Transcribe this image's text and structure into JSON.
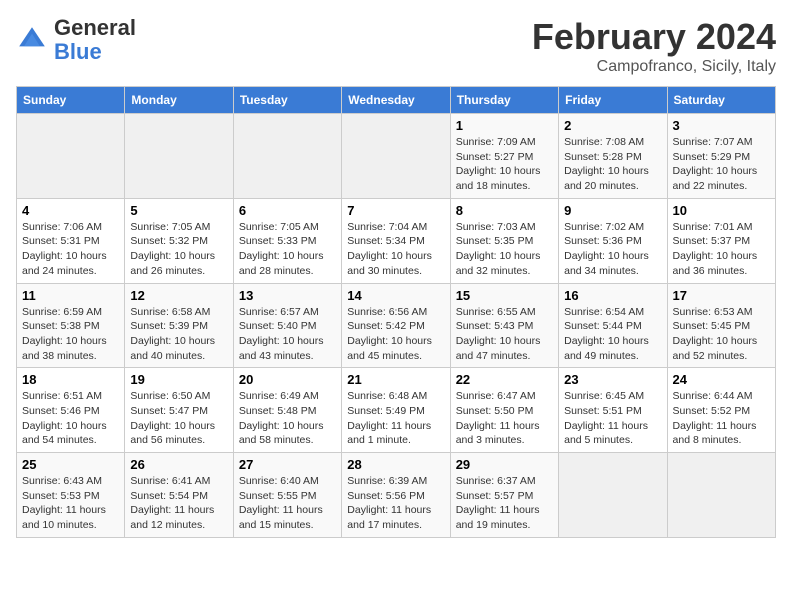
{
  "header": {
    "logo_general": "General",
    "logo_blue": "Blue",
    "title": "February 2024",
    "location": "Campofranco, Sicily, Italy"
  },
  "weekdays": [
    "Sunday",
    "Monday",
    "Tuesday",
    "Wednesday",
    "Thursday",
    "Friday",
    "Saturday"
  ],
  "weeks": [
    [
      {
        "day": "",
        "text": ""
      },
      {
        "day": "",
        "text": ""
      },
      {
        "day": "",
        "text": ""
      },
      {
        "day": "",
        "text": ""
      },
      {
        "day": "1",
        "text": "Sunrise: 7:09 AM\nSunset: 5:27 PM\nDaylight: 10 hours\nand 18 minutes."
      },
      {
        "day": "2",
        "text": "Sunrise: 7:08 AM\nSunset: 5:28 PM\nDaylight: 10 hours\nand 20 minutes."
      },
      {
        "day": "3",
        "text": "Sunrise: 7:07 AM\nSunset: 5:29 PM\nDaylight: 10 hours\nand 22 minutes."
      }
    ],
    [
      {
        "day": "4",
        "text": "Sunrise: 7:06 AM\nSunset: 5:31 PM\nDaylight: 10 hours\nand 24 minutes."
      },
      {
        "day": "5",
        "text": "Sunrise: 7:05 AM\nSunset: 5:32 PM\nDaylight: 10 hours\nand 26 minutes."
      },
      {
        "day": "6",
        "text": "Sunrise: 7:05 AM\nSunset: 5:33 PM\nDaylight: 10 hours\nand 28 minutes."
      },
      {
        "day": "7",
        "text": "Sunrise: 7:04 AM\nSunset: 5:34 PM\nDaylight: 10 hours\nand 30 minutes."
      },
      {
        "day": "8",
        "text": "Sunrise: 7:03 AM\nSunset: 5:35 PM\nDaylight: 10 hours\nand 32 minutes."
      },
      {
        "day": "9",
        "text": "Sunrise: 7:02 AM\nSunset: 5:36 PM\nDaylight: 10 hours\nand 34 minutes."
      },
      {
        "day": "10",
        "text": "Sunrise: 7:01 AM\nSunset: 5:37 PM\nDaylight: 10 hours\nand 36 minutes."
      }
    ],
    [
      {
        "day": "11",
        "text": "Sunrise: 6:59 AM\nSunset: 5:38 PM\nDaylight: 10 hours\nand 38 minutes."
      },
      {
        "day": "12",
        "text": "Sunrise: 6:58 AM\nSunset: 5:39 PM\nDaylight: 10 hours\nand 40 minutes."
      },
      {
        "day": "13",
        "text": "Sunrise: 6:57 AM\nSunset: 5:40 PM\nDaylight: 10 hours\nand 43 minutes."
      },
      {
        "day": "14",
        "text": "Sunrise: 6:56 AM\nSunset: 5:42 PM\nDaylight: 10 hours\nand 45 minutes."
      },
      {
        "day": "15",
        "text": "Sunrise: 6:55 AM\nSunset: 5:43 PM\nDaylight: 10 hours\nand 47 minutes."
      },
      {
        "day": "16",
        "text": "Sunrise: 6:54 AM\nSunset: 5:44 PM\nDaylight: 10 hours\nand 49 minutes."
      },
      {
        "day": "17",
        "text": "Sunrise: 6:53 AM\nSunset: 5:45 PM\nDaylight: 10 hours\nand 52 minutes."
      }
    ],
    [
      {
        "day": "18",
        "text": "Sunrise: 6:51 AM\nSunset: 5:46 PM\nDaylight: 10 hours\nand 54 minutes."
      },
      {
        "day": "19",
        "text": "Sunrise: 6:50 AM\nSunset: 5:47 PM\nDaylight: 10 hours\nand 56 minutes."
      },
      {
        "day": "20",
        "text": "Sunrise: 6:49 AM\nSunset: 5:48 PM\nDaylight: 10 hours\nand 58 minutes."
      },
      {
        "day": "21",
        "text": "Sunrise: 6:48 AM\nSunset: 5:49 PM\nDaylight: 11 hours\nand 1 minute."
      },
      {
        "day": "22",
        "text": "Sunrise: 6:47 AM\nSunset: 5:50 PM\nDaylight: 11 hours\nand 3 minutes."
      },
      {
        "day": "23",
        "text": "Sunrise: 6:45 AM\nSunset: 5:51 PM\nDaylight: 11 hours\nand 5 minutes."
      },
      {
        "day": "24",
        "text": "Sunrise: 6:44 AM\nSunset: 5:52 PM\nDaylight: 11 hours\nand 8 minutes."
      }
    ],
    [
      {
        "day": "25",
        "text": "Sunrise: 6:43 AM\nSunset: 5:53 PM\nDaylight: 11 hours\nand 10 minutes."
      },
      {
        "day": "26",
        "text": "Sunrise: 6:41 AM\nSunset: 5:54 PM\nDaylight: 11 hours\nand 12 minutes."
      },
      {
        "day": "27",
        "text": "Sunrise: 6:40 AM\nSunset: 5:55 PM\nDaylight: 11 hours\nand 15 minutes."
      },
      {
        "day": "28",
        "text": "Sunrise: 6:39 AM\nSunset: 5:56 PM\nDaylight: 11 hours\nand 17 minutes."
      },
      {
        "day": "29",
        "text": "Sunrise: 6:37 AM\nSunset: 5:57 PM\nDaylight: 11 hours\nand 19 minutes."
      },
      {
        "day": "",
        "text": ""
      },
      {
        "day": "",
        "text": ""
      }
    ]
  ]
}
